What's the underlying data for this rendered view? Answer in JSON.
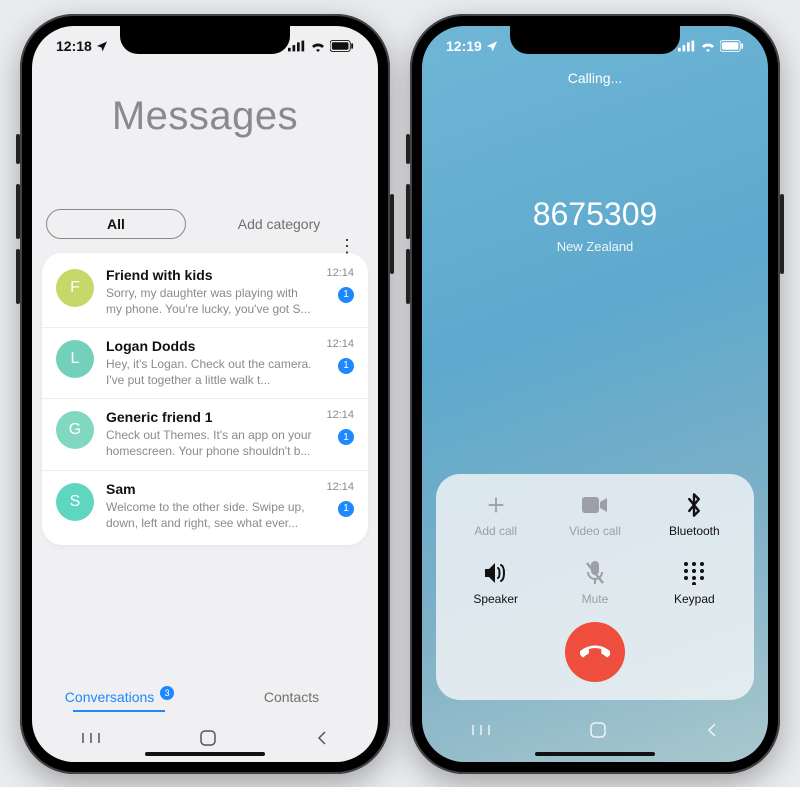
{
  "left": {
    "status": {
      "time": "12:18"
    },
    "title": "Messages",
    "pill": "All",
    "add_category": "Add category",
    "conversations": [
      {
        "initial": "F",
        "color": "#c7d86a",
        "name": "Friend with kids",
        "preview": "Sorry, my daughter was playing with my phone. You're lucky, you've got S...",
        "time": "12:14",
        "badge": "1"
      },
      {
        "initial": "L",
        "color": "#73d0bb",
        "name": "Logan Dodds",
        "preview": "Hey, it's Logan. Check out the camera. I've put together a little walk t...",
        "time": "12:14",
        "badge": "1"
      },
      {
        "initial": "G",
        "color": "#7fd8bf",
        "name": "Generic friend 1",
        "preview": "Check out Themes. It's an app on your homescreen. Your phone shouldn't b...",
        "time": "12:14",
        "badge": "1"
      },
      {
        "initial": "S",
        "color": "#5fd6c0",
        "name": "Sam",
        "preview": "Welcome to the other side. Swipe up, down, left and right, see what ever...",
        "time": "12:14",
        "badge": "1"
      }
    ],
    "tabs": {
      "conversations": "Conversations",
      "conversations_badge": "3",
      "contacts": "Contacts"
    }
  },
  "right": {
    "status": {
      "time": "12:19"
    },
    "calling": "Calling...",
    "number": "8675309",
    "location": "New Zealand",
    "buttons": {
      "add_call": "Add call",
      "video_call": "Video call",
      "bluetooth": "Bluetooth",
      "speaker": "Speaker",
      "mute": "Mute",
      "keypad": "Keypad"
    }
  }
}
